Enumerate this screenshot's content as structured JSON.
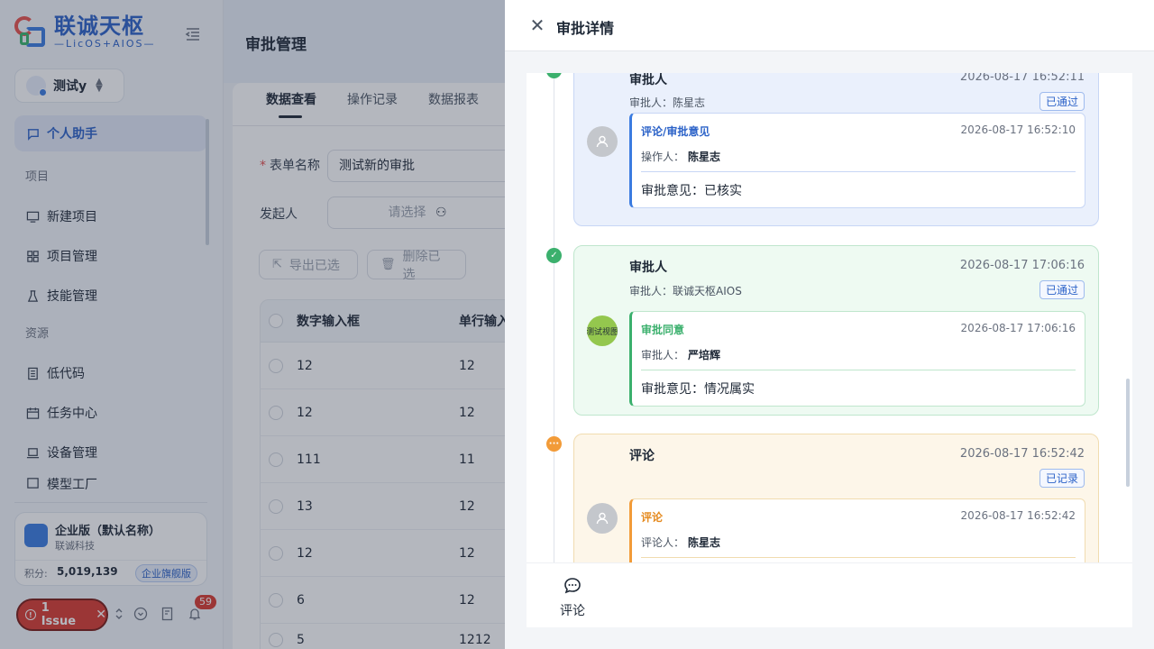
{
  "brand": {
    "title": "联诚天枢",
    "subtitle": "—LicOS+AIOS—"
  },
  "user": {
    "name": "测试y"
  },
  "sidebar": {
    "assistant": "个人助手",
    "section_project": "项目",
    "items_project": [
      "新建项目",
      "项目管理",
      "技能管理"
    ],
    "section_resource": "资源",
    "items_resource": [
      "低代码",
      "任务中心",
      "设备管理",
      "模型工厂"
    ]
  },
  "enterprise": {
    "name": "企业版（默认名称）",
    "company": "联诚科技",
    "points_label": "积分:",
    "points_value": "5,019,139",
    "edition_badge": "企业旗舰版"
  },
  "bottom": {
    "issue_label": "1 Issue",
    "notifications": "59"
  },
  "page": {
    "title": "审批管理",
    "tabs": [
      "数据查看",
      "操作记录",
      "数据报表"
    ],
    "form_name_label": "表单名称",
    "form_name_value": "测试新的审批",
    "initiator_label": "发起人",
    "initiator_placeholder": "请选择",
    "export_btn": "导出已选",
    "delete_btn": "删除已选",
    "table": {
      "headers": [
        "数字输入框",
        "单行输入"
      ],
      "rows": [
        [
          "12",
          "12"
        ],
        [
          "12",
          "12"
        ],
        [
          "111",
          "11"
        ],
        [
          "13",
          "12"
        ],
        [
          "12",
          "12"
        ],
        [
          "6",
          "12"
        ],
        [
          "5",
          "1212"
        ]
      ]
    }
  },
  "drawer": {
    "title": "审批详情",
    "entries": [
      {
        "title": "审批人",
        "time": "2026-08-17 16:52:11",
        "sub": "审批人：陈星志",
        "badge": "已通过",
        "inner_title": "评论/审批意见",
        "inner_time": "2026-08-17 16:52:10",
        "op_label": "操作人：",
        "op_name": "陈星志",
        "opinion": "审批意见：已核实"
      },
      {
        "title": "审批人",
        "time": "2026-08-17 17:06:16",
        "sub": "审批人：联诚天枢AIOS",
        "badge": "已通过",
        "avatar_text": "测试视图",
        "inner_title": "审批同意",
        "inner_time": "2026-08-17 17:06:16",
        "op_label": "审批人：",
        "op_name": "严培辉",
        "opinion": "审批意见：情况属实"
      },
      {
        "title": "评论",
        "time": "2026-08-17 16:52:42",
        "badge": "已记录",
        "inner_title": "评论",
        "inner_time": "2026-08-17 16:52:42",
        "op_label": "评论人：",
        "op_name": "陈星志"
      }
    ],
    "footer_comment": "评论"
  },
  "colors": {
    "primary": "#2b62c8",
    "success": "#3bb06d",
    "warning": "#f29b38",
    "danger": "#d93a2f"
  }
}
